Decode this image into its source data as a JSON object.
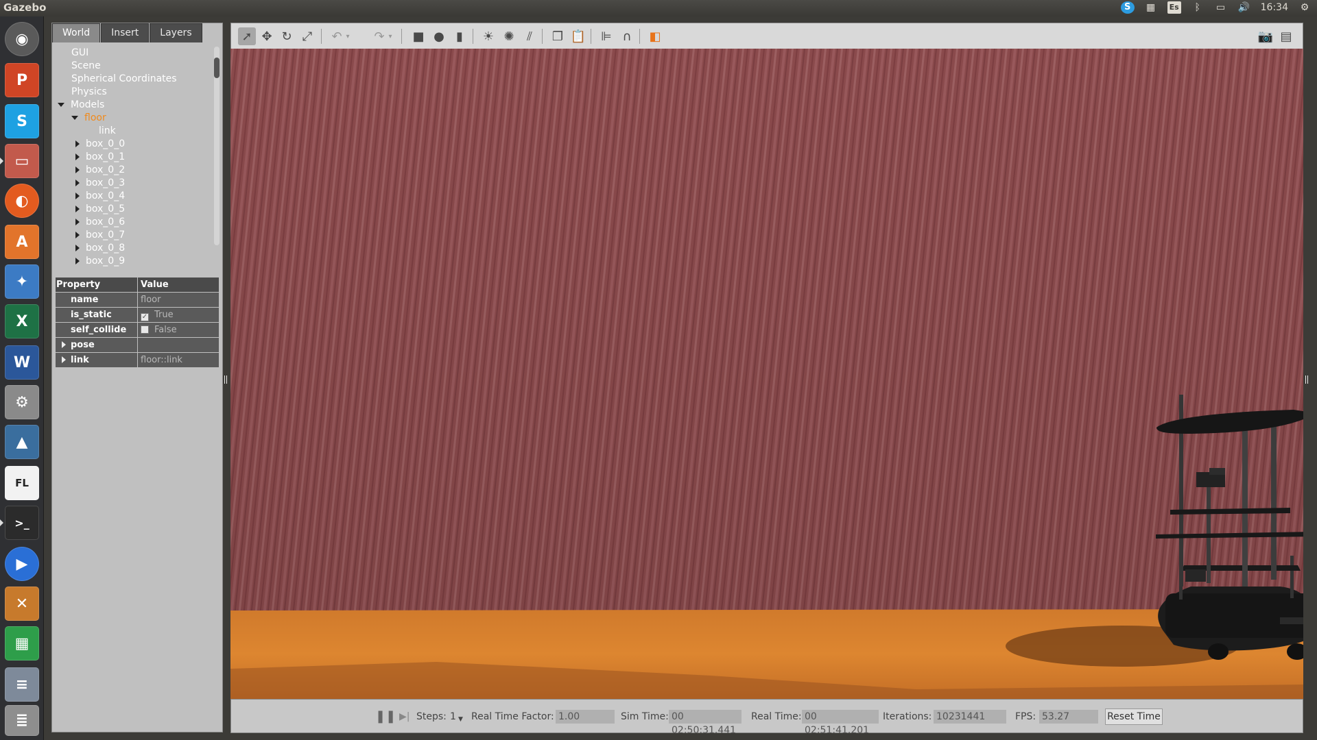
{
  "topbar": {
    "title": "Gazebo",
    "time": "16:34",
    "lang": "Es",
    "icons": [
      "skype-tray-icon",
      "workspaces-icon",
      "keyboard-lang-icon",
      "bluetooth-icon",
      "battery-icon",
      "volume-icon",
      "clock",
      "settings-gear-icon"
    ]
  },
  "launcher": {
    "apps": [
      "ubuntu-dash",
      "powerpoint",
      "skype",
      "files",
      "firefox",
      "software-center",
      "windows-app",
      "excel",
      "word",
      "system-settings",
      "matlab",
      "fl-editor",
      "terminal",
      "media-player",
      "virtualbox",
      "spreadsheet",
      "workspace-stack"
    ]
  },
  "tabs": [
    "World",
    "Insert",
    "Layers"
  ],
  "tree": {
    "top_items": [
      "GUI",
      "Scene",
      "Spherical Coordinates",
      "Physics"
    ],
    "models_label": "Models",
    "selected_model": "floor",
    "selected_child": "link",
    "models": [
      "box_0_0",
      "box_0_1",
      "box_0_2",
      "box_0_3",
      "box_0_4",
      "box_0_5",
      "box_0_6",
      "box_0_7",
      "box_0_8",
      "box_0_9"
    ]
  },
  "properties": {
    "header_property": "Property",
    "header_value": "Value",
    "rows": [
      {
        "key": "name",
        "value": "floor"
      },
      {
        "key": "is_static",
        "value": "True",
        "checked": true
      },
      {
        "key": "self_collide",
        "value": "False",
        "checked": false
      },
      {
        "key": "pose",
        "value": ""
      },
      {
        "key": "link",
        "value": "floor::link"
      }
    ]
  },
  "bottombar": {
    "steps_label": "Steps:",
    "steps_value": "1",
    "rtf_label": "Real Time Factor:",
    "rtf_value": "1.00",
    "sim_label": "Sim Time:",
    "sim_value": "00 02:50:31.441",
    "real_label": "Real Time:",
    "real_value": "00 02:51:41.201",
    "iter_label": "Iterations:",
    "iter_value": "10231441",
    "fps_label": "FPS:",
    "fps_value": "53.27",
    "reset_label": "Reset Time"
  },
  "colors": {
    "wall": "#8c4d4f",
    "floor": "#d8802e",
    "selected": "#f08a1c"
  }
}
